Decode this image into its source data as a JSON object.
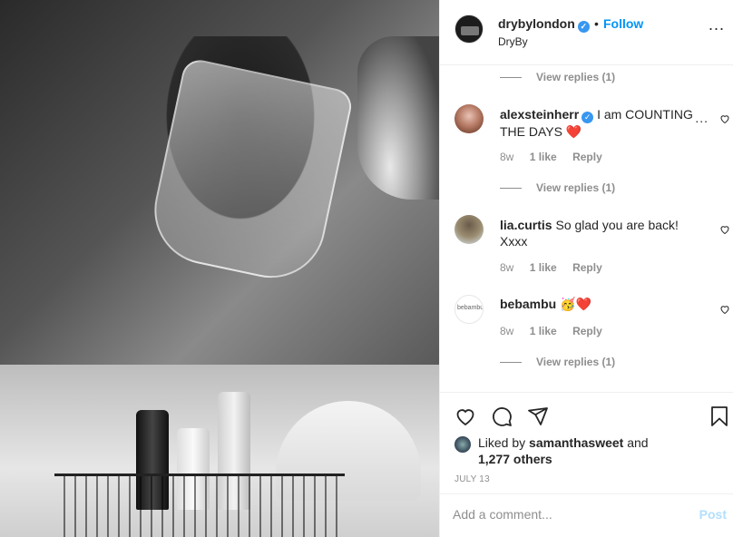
{
  "post": {
    "image_alt": ""
  },
  "header": {
    "username": "drybylondon",
    "verified_glyph": "✓",
    "separator": "•",
    "follow_label": "Follow",
    "subtitle": "DryBy",
    "more_label": "..."
  },
  "comments": {
    "view_replies_1": "View replies (1)",
    "items": [
      {
        "username": "alexsteinherr",
        "verified_glyph": "✓",
        "text": "I am COUNTING THE DAYS",
        "emoji": "❤️",
        "time": "8w",
        "likes": "1 like",
        "reply": "Reply",
        "more": "...",
        "view_replies": "View replies (1)"
      },
      {
        "username": "lia.curtis",
        "text": "So glad you are back! Xxxx",
        "time": "8w",
        "likes": "1 like",
        "reply": "Reply"
      },
      {
        "username": "bebambu",
        "avatar_text": "bebambu",
        "emoji": "🥳❤️",
        "time": "8w",
        "likes": "1 like",
        "reply": "Reply",
        "view_replies": "View replies (1)"
      }
    ]
  },
  "actions": {
    "liked_prefix": "Liked by",
    "liked_user": "samanthasweet",
    "liked_and": "and",
    "liked_others": "1,277 others",
    "date": "JULY 13"
  },
  "add_comment": {
    "placeholder": "Add a comment...",
    "post_label": "Post"
  },
  "colors": {
    "accent": "#0095f6",
    "verified": "#3897f0",
    "heart": "#ed4956",
    "muted": "#8e8e8e",
    "post_disabled": "#b2dffc"
  },
  "icons": [
    "heart-icon",
    "comment-icon",
    "share-icon",
    "bookmark-icon",
    "more-icon",
    "verified-icon"
  ]
}
